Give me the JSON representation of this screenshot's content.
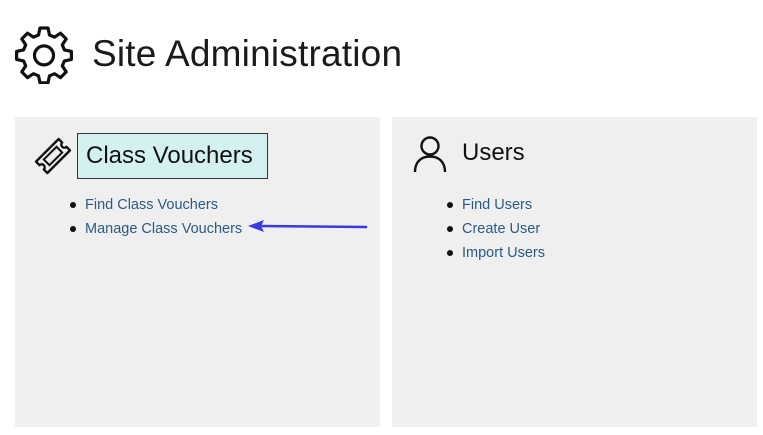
{
  "header": {
    "title": "Site Administration",
    "icon": "gear-icon"
  },
  "panels": {
    "vouchers": {
      "title": "Class Vouchers",
      "icon": "ticket-icon",
      "highlight_color": "#d4f1f1",
      "links": [
        {
          "label": "Find Class Vouchers"
        },
        {
          "label": "Manage Class Vouchers"
        }
      ]
    },
    "users": {
      "title": "Users",
      "icon": "user-icon",
      "links": [
        {
          "label": "Find Users"
        },
        {
          "label": "Create User"
        },
        {
          "label": "Import Users"
        }
      ]
    }
  },
  "annotation": {
    "arrow_color": "#3a3ae0",
    "arrow_target": "Manage Class Vouchers"
  },
  "colors": {
    "panel_bg": "#efefef",
    "link": "#2c5a85"
  }
}
